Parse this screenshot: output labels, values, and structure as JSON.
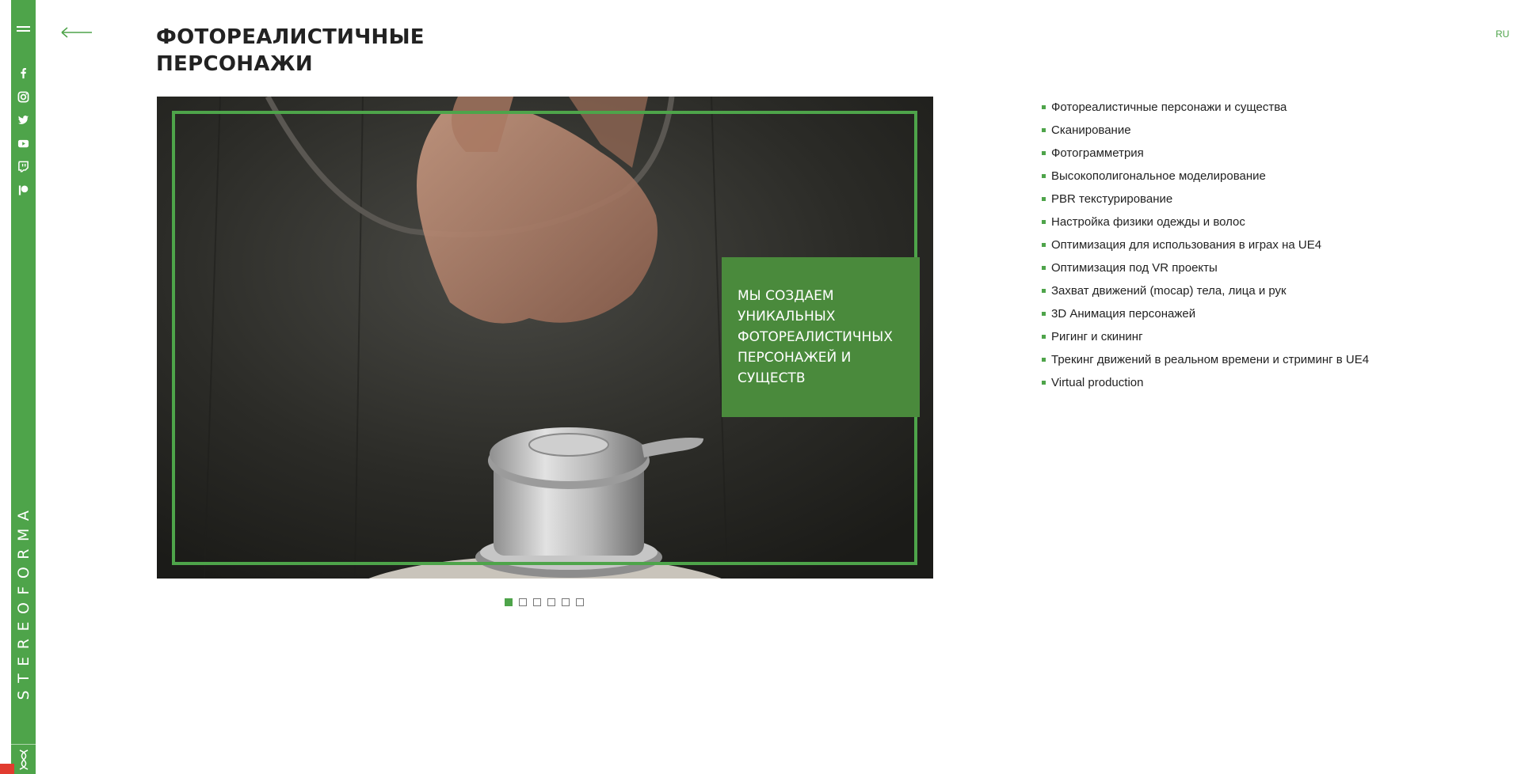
{
  "page": {
    "title": "ФОТОРЕАЛИСТИЧНЫЕ ПЕРСОНАЖИ",
    "lang": "RU"
  },
  "sidebar": {
    "brand": "STEREOFORMA",
    "icons": [
      "menu-icon",
      "facebook-icon",
      "instagram-icon",
      "twitter-icon",
      "youtube-icon",
      "twitch-icon",
      "patreon-icon",
      "logo-icon"
    ]
  },
  "slider": {
    "caption": "МЫ СОЗДАЕМ УНИКАЛЬНЫХ ФОТОРЕАЛИСТИЧНЫХ ПЕРСОНАЖЕЙ И СУЩЕСТВ",
    "dots": 6,
    "active_dot": 1
  },
  "services": [
    "Фотореалистичные персонажи и существа",
    "Сканирование",
    "Фотограмметрия",
    "Высокополигональное моделирование",
    "PBR текстурирование",
    "Настройка физики одежды и волос",
    "Оптимизация для использования в играх на UE4",
    "Оптимизация под VR проекты",
    "Захват движений (mocap) тела, лица и рук",
    "3D Анимация персонажей",
    "Ригинг и скининг",
    "Трекинг движений в реальном времени и стриминг в UE4",
    "Virtual production"
  ],
  "colors": {
    "accent": "#4ea44a",
    "caption_bg": "#4a8a3c"
  }
}
